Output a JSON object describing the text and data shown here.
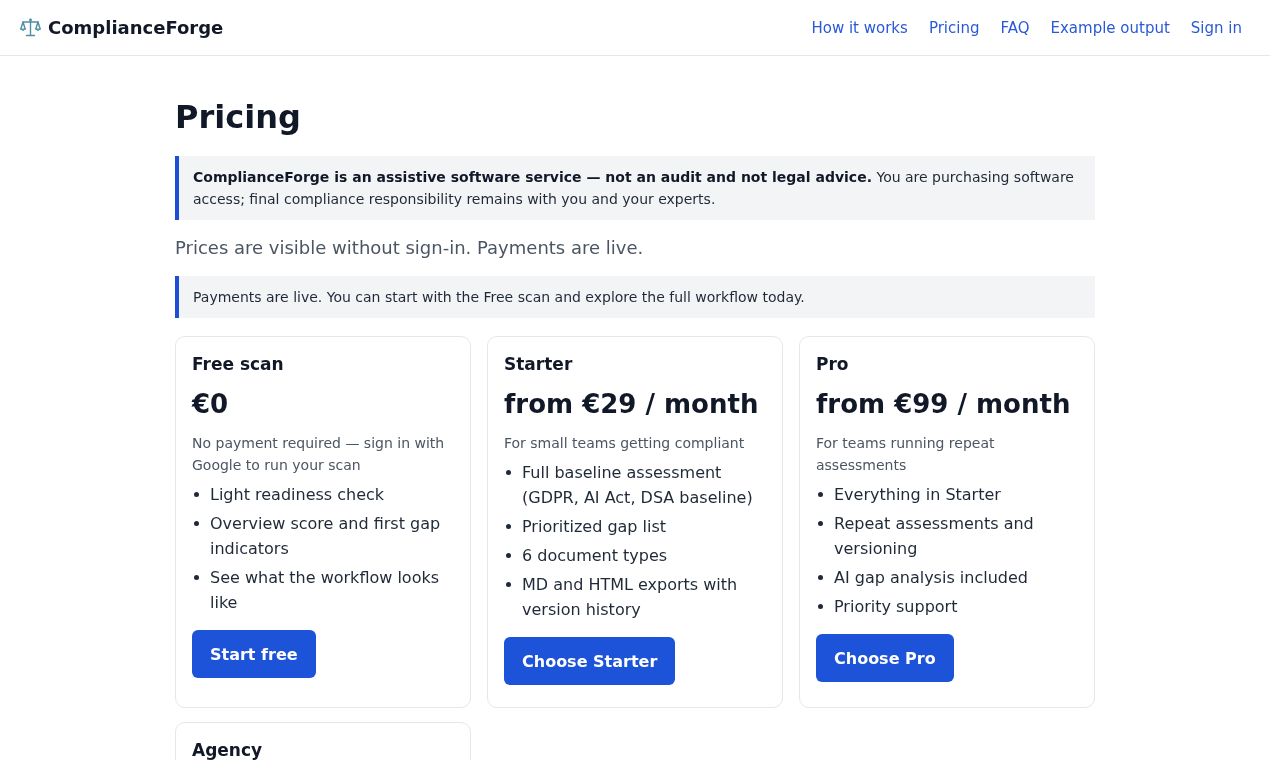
{
  "header": {
    "brand": "ComplianceForge",
    "nav": [
      {
        "label": "How it works"
      },
      {
        "label": "Pricing"
      },
      {
        "label": "FAQ"
      },
      {
        "label": "Example output"
      },
      {
        "label": "Sign in"
      }
    ]
  },
  "page": {
    "title": "Pricing",
    "disclaimer": "**ComplianceForge is an assistive software service — not an audit and not legal advice.** You are purchasing software access; final compliance responsibility remains with you and your experts.",
    "lead": "Prices are visible without sign-in. Payments are live.",
    "notice": "Payments are live. You can start with the Free scan and explore the full workflow today."
  },
  "plans": [
    {
      "name": "Free scan",
      "price": "€0",
      "description": "No payment required — sign in with Google to run your scan",
      "features": [
        "Light readiness check",
        "Overview score and first gap indicators",
        "See what the workflow looks like"
      ],
      "button": "Start free"
    },
    {
      "name": "Starter",
      "price": "from €29 / month",
      "description": "For small teams getting compliant",
      "features": [
        "Full baseline assessment (GDPR, AI Act, DSA baseline)",
        "Prioritized gap list",
        "6 document types",
        "MD and HTML exports with version history"
      ],
      "button": "Choose Starter"
    },
    {
      "name": "Pro",
      "price": "from €99 / month",
      "description": "For teams running repeat assessments",
      "features": [
        "Everything in Starter",
        "Repeat assessments and versioning",
        "AI gap analysis included",
        "Priority support"
      ],
      "button": "Choose Pro"
    },
    {
      "name": "Agency"
    }
  ]
}
